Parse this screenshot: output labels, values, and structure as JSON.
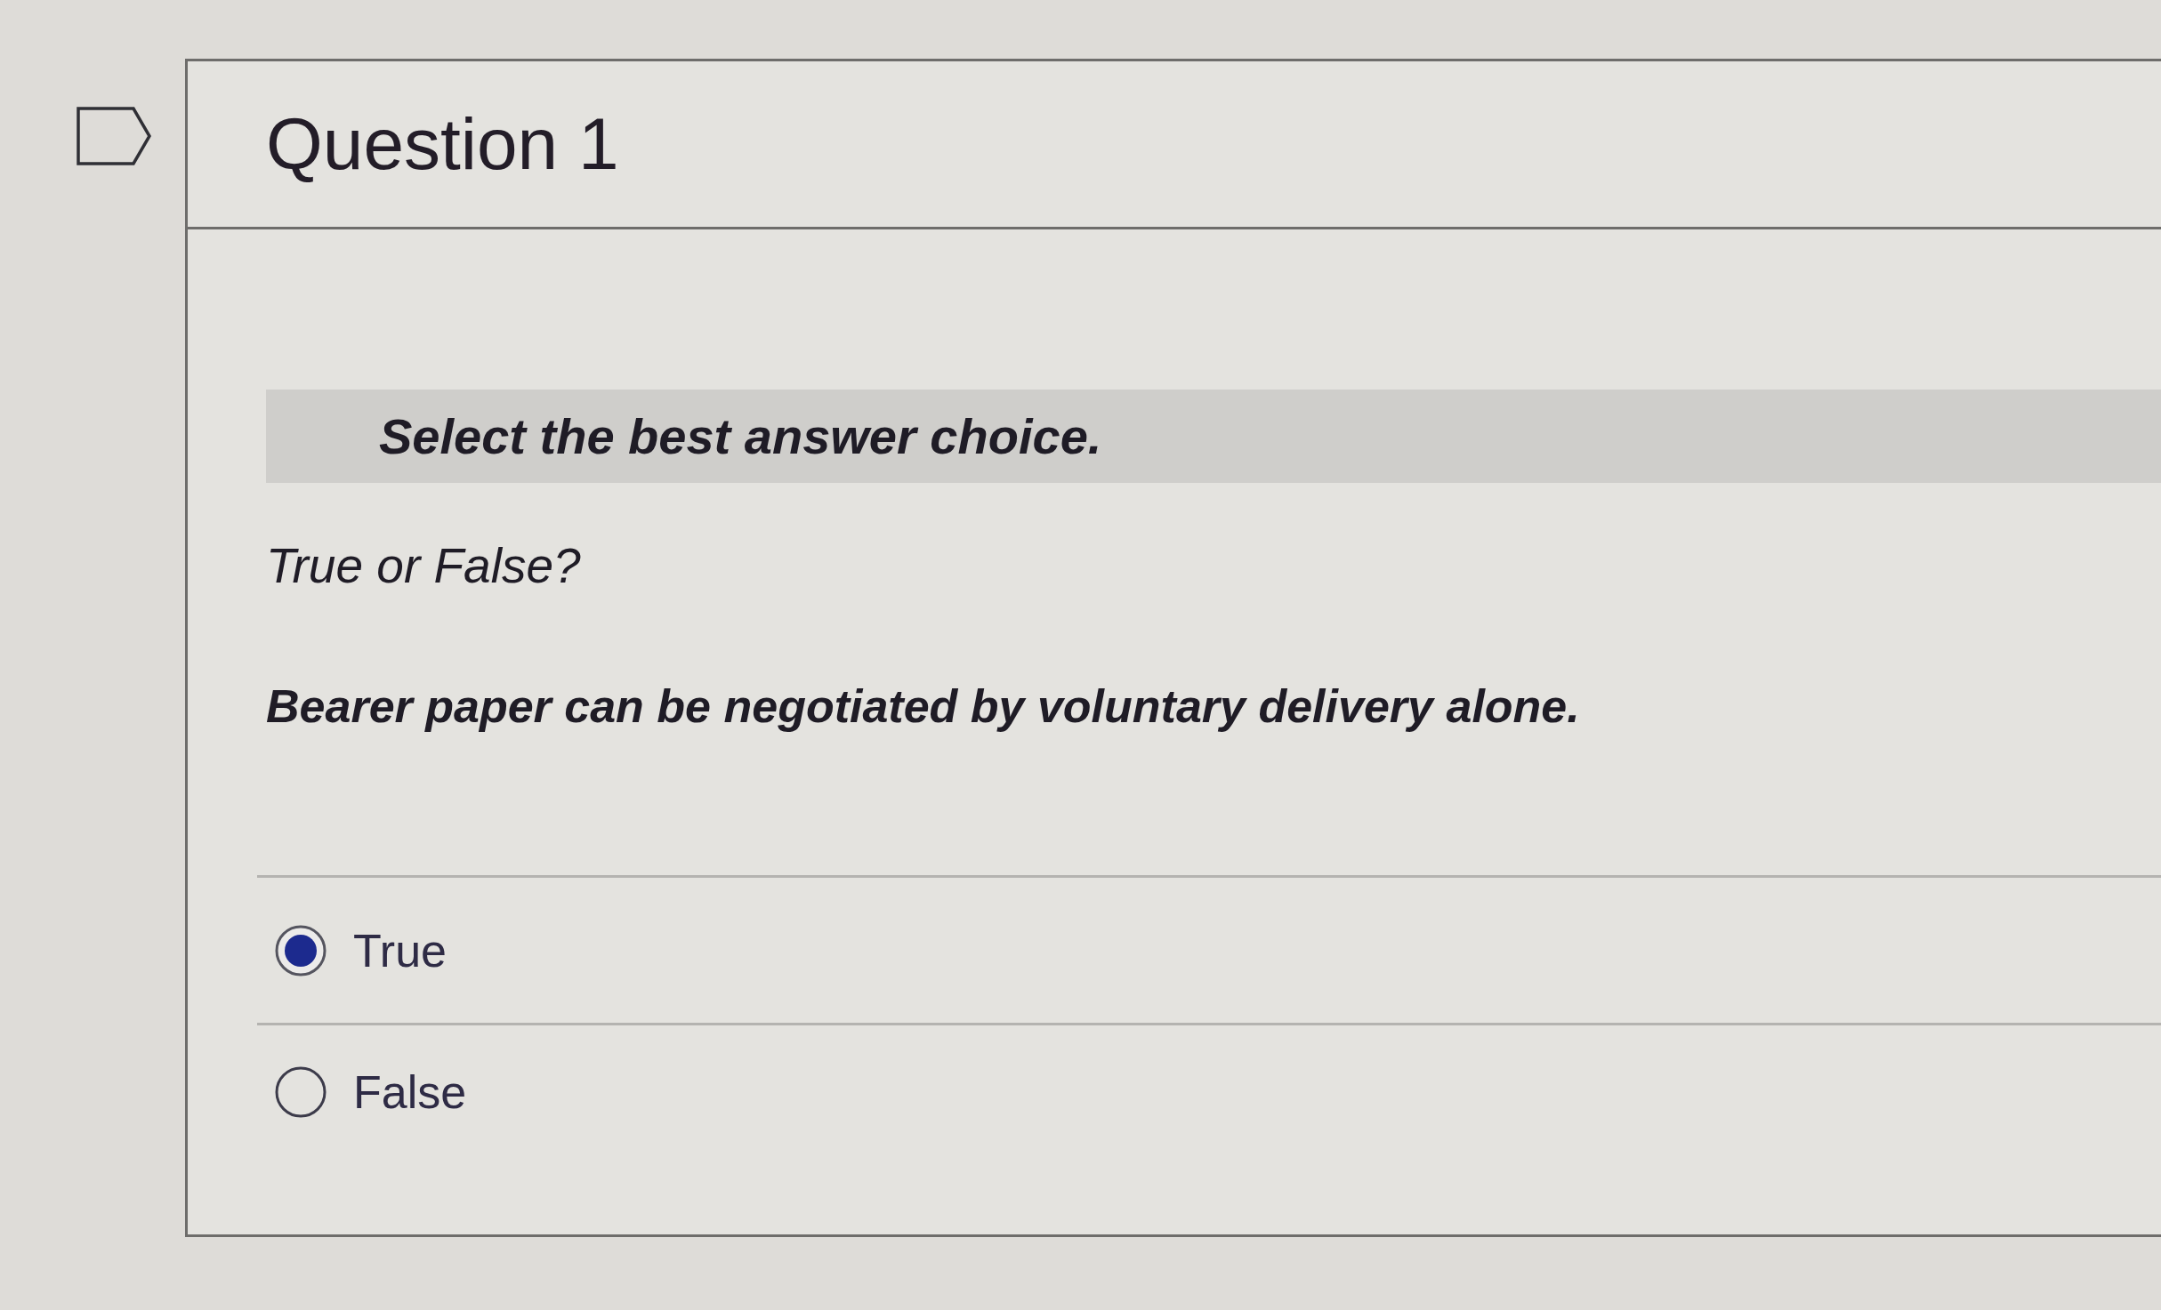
{
  "question": {
    "flagged": false,
    "title": "Question 1"
  },
  "instruction": "Select the best answer choice.",
  "prompt": "True or False?",
  "statement": "Bearer paper can be negotiated by voluntary delivery alone.",
  "choices": [
    {
      "label": "True",
      "selected": true
    },
    {
      "label": "False",
      "selected": false
    }
  ]
}
